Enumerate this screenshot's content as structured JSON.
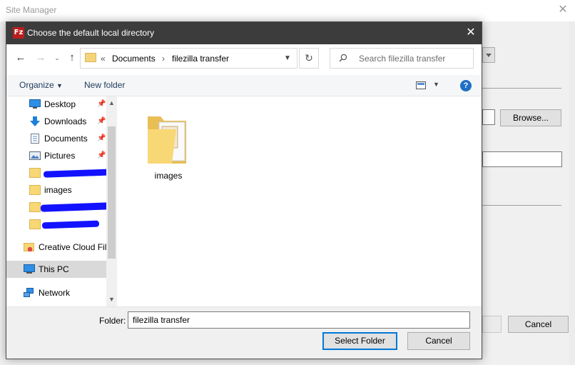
{
  "background_window": {
    "title": "Site Manager",
    "browse_label": "Browse...",
    "cancel_label": "Cancel"
  },
  "dialog": {
    "title": "Choose the default local directory",
    "app_icon": "filezilla-icon",
    "breadcrumb": {
      "overflow": "«",
      "parts": [
        "Documents",
        "filezilla transfer"
      ]
    },
    "search_placeholder": "Search filezilla transfer",
    "command_bar": {
      "organize": "Organize",
      "new_folder": "New folder"
    },
    "nav": {
      "items": [
        {
          "label": "Desktop",
          "icon": "desktop-icon",
          "pinned": true
        },
        {
          "label": "Downloads",
          "icon": "download-arrow-icon",
          "pinned": true
        },
        {
          "label": "Documents",
          "icon": "document-icon",
          "pinned": true
        },
        {
          "label": "Pictures",
          "icon": "pictures-icon",
          "pinned": true
        },
        {
          "label": "images",
          "icon": "folder-icon",
          "pinned": false
        }
      ],
      "creative_cloud": "Creative Cloud Fil",
      "this_pc": "This PC",
      "network": "Network"
    },
    "content": {
      "items": [
        {
          "label": "images",
          "icon": "folder-with-pictures-icon"
        }
      ]
    },
    "footer": {
      "folder_label": "Folder:",
      "folder_value": "filezilla transfer",
      "select_folder": "Select Folder",
      "cancel": "Cancel"
    }
  },
  "colors": {
    "dialog_titlebar": "#3c3c3c",
    "accent": "#0078d7",
    "folder_yellow": "#f8d775",
    "redaction": "#1212ff"
  }
}
